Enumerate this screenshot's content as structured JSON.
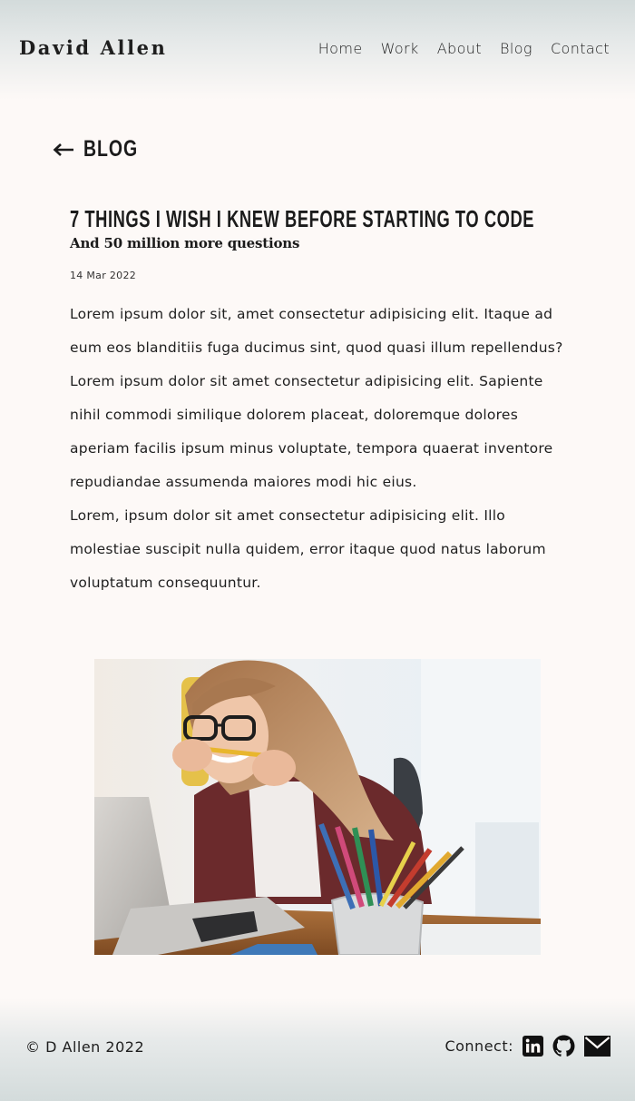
{
  "header": {
    "brand": "David Allen",
    "nav": [
      "Home",
      "Work",
      "About",
      "Blog",
      "Contact"
    ]
  },
  "back_link": {
    "icon": "arrow-left-icon",
    "label": "BLOG"
  },
  "post": {
    "title": "7 THINGS I WISH I KNEW BEFORE STARTING TO CODE",
    "subtitle": "And 50 million more questions",
    "date": "14 Mar 2022",
    "paragraphs": [
      "Lorem ipsum dolor sit, amet consectetur adipisicing elit. Itaque ad eum eos blanditiis fuga ducimus sint, quod quasi illum repellendus?",
      "Lorem ipsum dolor sit amet consectetur adipisicing elit. Sapiente nihil commodi similique dolorem placeat, doloremque dolores aperiam facilis ipsum minus voluptate, tempora quaerat inventore repudiandae assumenda maiores modi hic eius.",
      "Lorem, ipsum dolor sit amet consectetur adipisicing elit. Illo molestiae suscipit nulla quidem, error itaque quod natus laborum voluptatum consequuntur."
    ]
  },
  "footer": {
    "copyright": "© D Allen 2022",
    "connect_label": "Connect:",
    "social": [
      "linkedin-icon",
      "github-icon",
      "mail-icon"
    ]
  },
  "colors": {
    "background": "#fdf9f7",
    "header_gradient": "#d3dbdb",
    "text": "#1b1b1b"
  }
}
